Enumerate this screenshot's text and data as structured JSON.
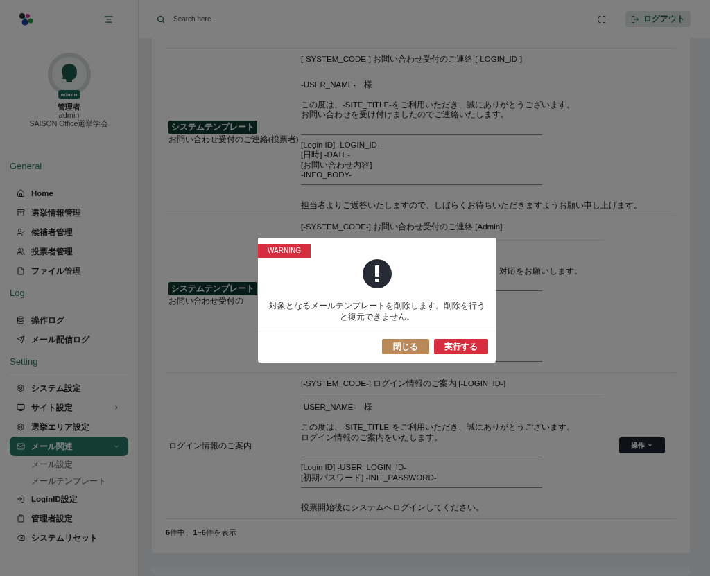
{
  "header": {
    "search": {
      "placeholder": "Search here .."
    },
    "logout_button": "ログアウト"
  },
  "sidebar": {
    "profile": {
      "badge": "admin",
      "name": "管理者",
      "login": "admin",
      "organization": "SAISON Office選挙学会"
    },
    "groups": [
      {
        "title": "General",
        "divider": false,
        "items": [
          {
            "label": "Home",
            "selected": false
          },
          {
            "label": "選挙情報管理",
            "selected": false
          },
          {
            "label": "候補者管理",
            "selected": false
          },
          {
            "label": "投票者管理",
            "selected": false
          },
          {
            "label": "ファイル管理",
            "selected": false
          }
        ]
      },
      {
        "title": "Log",
        "divider": false,
        "items": [
          {
            "label": "操作ログ",
            "selected": false
          },
          {
            "label": "メール配信ログ",
            "selected": false
          }
        ]
      },
      {
        "title": "Setting",
        "divider": true,
        "items": [
          {
            "label": "システム設定",
            "selected": false
          },
          {
            "label": "サイト設定",
            "selected": false,
            "expanded": false
          },
          {
            "label": "選挙エリア設定",
            "selected": false
          },
          {
            "label": "メール関連",
            "selected": true,
            "expanded": true,
            "children": [
              {
                "label": "メール設定",
                "selected": false
              },
              {
                "label": "メールテンプレート",
                "selected": false
              }
            ]
          },
          {
            "label": "LoginID設定",
            "selected": false
          },
          {
            "label": "管理者設定",
            "selected": false
          },
          {
            "label": "システムリセット",
            "selected": false
          }
        ]
      }
    ]
  },
  "table": {
    "rows": [
      {
        "badge": "システムテンプレート",
        "name": "お問い合わせ受付のご連絡(投票者)",
        "subject": "[-SYSTEM_CODE-] お問い合わせ受付のご連絡 [-LOGIN_ID-]",
        "subject_rule": false,
        "body": [
          {
            "kind": "text",
            "text": "-USER_NAME-　様"
          },
          {
            "kind": "blank"
          },
          {
            "kind": "text",
            "text": "この度は、-SITE_TITLE-をご利用いただき、誠にありがとうございます。"
          },
          {
            "kind": "text",
            "text": "お問い合わせを受け付けましたのでご連絡いたします。"
          },
          {
            "kind": "blank"
          },
          {
            "kind": "rule"
          },
          {
            "kind": "text",
            "text": "[Login ID] -LOGIN_ID-"
          },
          {
            "kind": "text",
            "text": "[日時] -DATE-"
          },
          {
            "kind": "text",
            "text": "[お問い合わせ内容]"
          },
          {
            "kind": "text",
            "text": "-INFO_BODY-"
          },
          {
            "kind": "rule"
          },
          {
            "kind": "blank"
          },
          {
            "kind": "text",
            "text": "担当者よりご返答いたしますので、しばらくお待ちいただきますようお願い申し上げます。"
          }
        ]
      },
      {
        "badge": "システムテンプレート",
        "name": "お問い合わせ受付の",
        "subject": "[-SYSTEM_CODE-] お問い合わせ受付のご連絡 [Admin]",
        "subject_rule": true,
        "body": [
          {
            "kind": "blank"
          },
          {
            "kind": "blank"
          },
          {
            "kind": "partial",
            "text": "対応をお願いします。"
          },
          {
            "kind": "blank"
          },
          {
            "kind": "rule"
          },
          {
            "kind": "blank"
          },
          {
            "kind": "blank"
          },
          {
            "kind": "blank"
          },
          {
            "kind": "blank"
          },
          {
            "kind": "blank"
          },
          {
            "kind": "blank"
          },
          {
            "kind": "rule"
          }
        ]
      },
      {
        "name": "ログイン情報のご案内",
        "subject": "[-SYSTEM_CODE-] ログイン情報のご案内 [-LOGIN_ID-]",
        "subject_rule": true,
        "action": "操作",
        "body": [
          {
            "kind": "text",
            "text": "-USER_NAME-　様"
          },
          {
            "kind": "blank"
          },
          {
            "kind": "text",
            "text": "この度は、-SITE_TITLE-をご利用いただき、誠にありがとうございます。"
          },
          {
            "kind": "text",
            "text": "ログイン情報のご案内をいたします。"
          },
          {
            "kind": "blank"
          },
          {
            "kind": "rule"
          },
          {
            "kind": "text",
            "text": "[Login ID] -USER_LOGIN_ID-"
          },
          {
            "kind": "text",
            "text": "[初期パスワード] -INIT_PASSWORD-"
          },
          {
            "kind": "rule"
          },
          {
            "kind": "blank"
          },
          {
            "kind": "text",
            "text": "投票開始後にシステムへログインしてください。"
          }
        ]
      }
    ],
    "summary": "**6**件中、**1~6**件を表示"
  },
  "dialog": {
    "label": "WARNING",
    "message": "対象となるメールテンプレートを削除します。削除を行うと復元できません。",
    "buttons": [
      {
        "label": "閉じる",
        "kind": "secondary"
      },
      {
        "label": "実行する",
        "kind": "danger"
      }
    ]
  }
}
